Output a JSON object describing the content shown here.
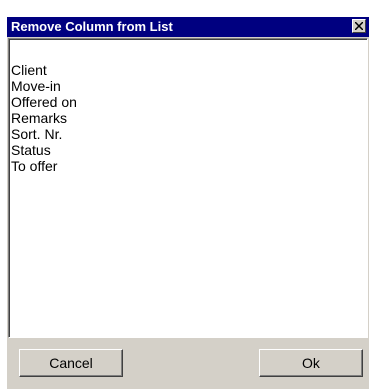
{
  "dialog": {
    "title": "Remove Column from List",
    "close_icon": "close-x-icon"
  },
  "list": {
    "items": [
      {
        "label": "Client"
      },
      {
        "label": "Move-in"
      },
      {
        "label": "Offered on"
      },
      {
        "label": "Remarks"
      },
      {
        "label": "Sort. Nr."
      },
      {
        "label": "Status"
      },
      {
        "label": "To offer"
      }
    ]
  },
  "buttons": {
    "cancel_label": "Cancel",
    "ok_label": "Ok"
  },
  "colors": {
    "titlebar": "#000080",
    "dialog_face": "#d4d0c8",
    "list_background": "#ffffff"
  }
}
